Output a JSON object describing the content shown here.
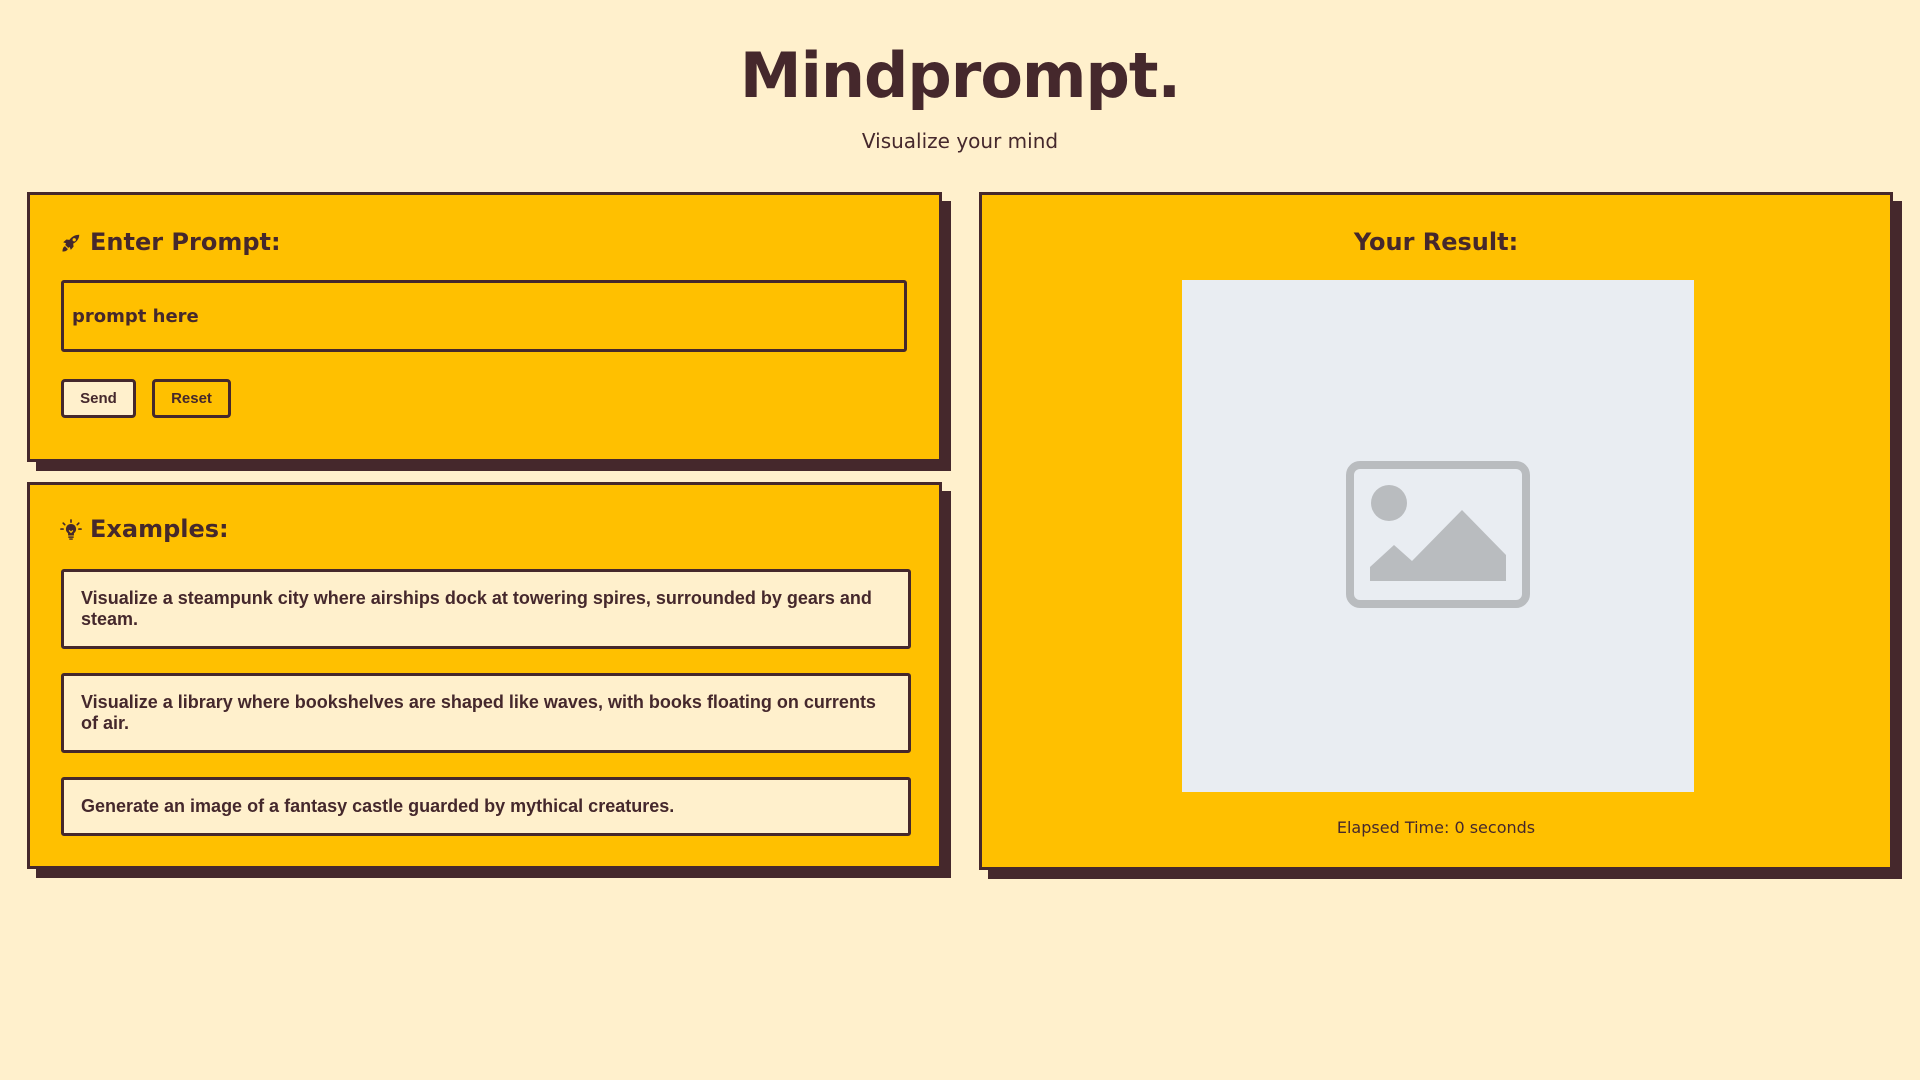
{
  "header": {
    "title": "Mindprompt.",
    "subtitle": "Visualize your mind"
  },
  "prompt_card": {
    "heading": "Enter Prompt:",
    "heading_icon": "rocket-icon",
    "input_placeholder": "prompt here",
    "input_value": "",
    "send_label": "Send",
    "reset_label": "Reset"
  },
  "examples_card": {
    "heading": "Examples:",
    "heading_icon": "lightbulb-icon",
    "items": [
      "Visualize a steampunk city where airships dock at towering spires, surrounded by gears and steam.",
      "Visualize a library where bookshelves are shaped like waves, with books floating on currents of air.",
      "Generate an image of a fantasy castle guarded by mythical creatures."
    ]
  },
  "result_card": {
    "heading": "Your Result:",
    "image_icon": "image-placeholder-icon",
    "elapsed_text": "Elapsed Time: 0 seconds"
  },
  "colors": {
    "background": "#fff0cc",
    "accent": "#ffc000",
    "text": "#45282c",
    "image_placeholder_bg": "#e9edf2",
    "image_placeholder_icon": "#b9bcbf"
  }
}
